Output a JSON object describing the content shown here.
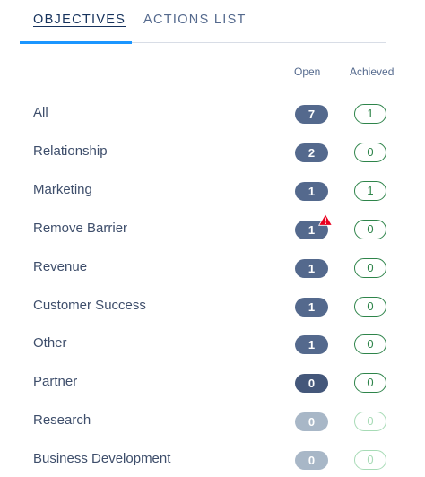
{
  "tabs": {
    "objectives": "OBJECTIVES",
    "actions_list": "ACTIONS LIST"
  },
  "columns": {
    "open": "Open",
    "achieved": "Achieved"
  },
  "rows": [
    {
      "label": "All",
      "open": "7",
      "achieved": "1"
    },
    {
      "label": "Relationship",
      "open": "2",
      "achieved": "0"
    },
    {
      "label": "Marketing",
      "open": "1",
      "achieved": "1"
    },
    {
      "label": "Remove Barrier",
      "open": "1",
      "achieved": "0",
      "warning": true
    },
    {
      "label": "Revenue",
      "open": "1",
      "achieved": "0"
    },
    {
      "label": "Customer Success",
      "open": "1",
      "achieved": "0"
    },
    {
      "label": "Other",
      "open": "1",
      "achieved": "0"
    },
    {
      "label": "Partner",
      "open": "0",
      "achieved": "0"
    },
    {
      "label": "Research",
      "open": "0",
      "achieved": "0",
      "muted": true
    },
    {
      "label": "Business Development",
      "open": "0",
      "achieved": "0",
      "muted": true
    }
  ],
  "colors": {
    "active_tab": "#1b96ff",
    "open_pill": "#54698d",
    "open_pill_muted": "#a8b7c7",
    "achieved": "#2e844a",
    "achieved_muted": "#a7dbb6",
    "warning": "#ea001e"
  },
  "icons": {
    "warning": "warning-triangle-icon"
  }
}
